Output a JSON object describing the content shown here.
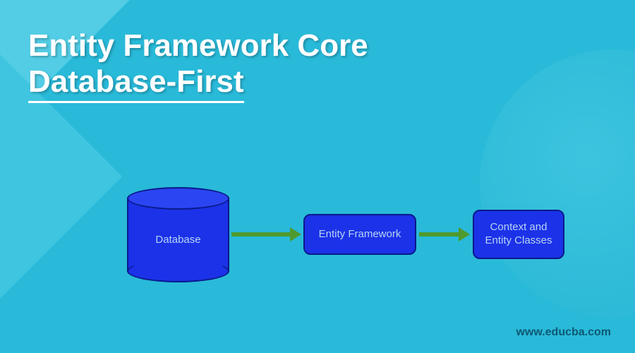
{
  "title": {
    "line1": "Entity Framework Core",
    "line2": "Database-First"
  },
  "diagram": {
    "node1": "Database",
    "node2": "Entity Framework",
    "node3": "Context and\nEntity Classes"
  },
  "footer": {
    "url": "www.educba.com"
  },
  "colors": {
    "background": "#29bad9",
    "node_fill": "#1b32e8",
    "node_border": "#0a1a8a",
    "arrow": "#4f9a2e"
  }
}
